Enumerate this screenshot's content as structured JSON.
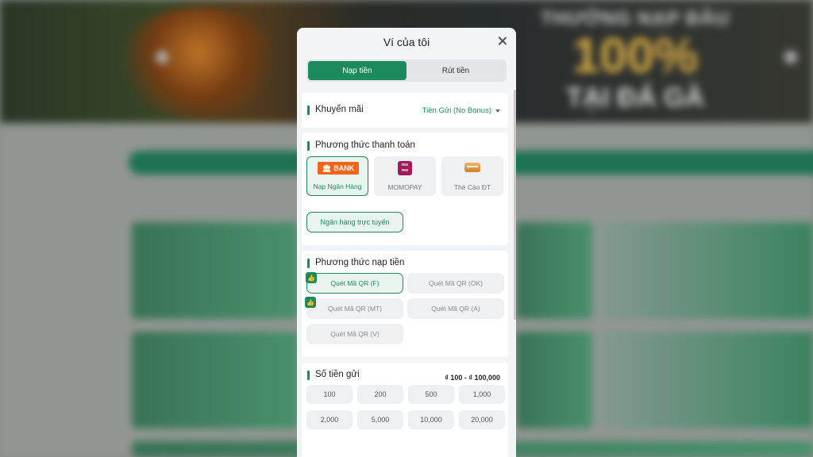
{
  "background": {
    "promo_line1": "THƯỞNG NẠP ĐẦU",
    "promo_line2": "100%",
    "promo_line3": "TẠI ĐÁ GÀ"
  },
  "wallet": {
    "title": "Ví của tôi",
    "tabs": [
      {
        "label": "Nạp tiền",
        "active": true
      },
      {
        "label": "Rút tiền",
        "active": false
      }
    ],
    "promotion": {
      "label": "Khuyến mãi",
      "selected": "Tiền Gửi (No Bonus)"
    },
    "payment_method": {
      "label": "Phương thức thanh toán",
      "options": [
        {
          "label": "Nạp Ngân Hàng",
          "icon": "bank-logo",
          "logo_text": "BANK",
          "active": true
        },
        {
          "label": "MOMOPAY",
          "icon": "momo-logo",
          "logo_text": "mo mo",
          "active": false
        },
        {
          "label": "Thẻ Cào ĐT",
          "icon": "phone-card-icon",
          "active": false
        }
      ],
      "sub_option": "Ngân hàng trực tuyến"
    },
    "deposit_method": {
      "label": "Phương thức nạp tiền",
      "options": [
        {
          "label": "Quét Mã QR (F)",
          "recommended": true,
          "active": true
        },
        {
          "label": "Quét Mã QR (OK)",
          "recommended": false,
          "active": false
        },
        {
          "label": "Quét Mã QR (MT)",
          "recommended": true,
          "active": false
        },
        {
          "label": "Quét Mã QR (A)",
          "recommended": false,
          "active": false
        },
        {
          "label": "Quét Mã QR (V)",
          "recommended": false,
          "active": false
        }
      ]
    },
    "deposit_amount": {
      "label": "Số tiền gửi",
      "range": "₫ 100 - ₫ 100,000",
      "amounts": [
        "100",
        "200",
        "500",
        "1,000",
        "2,000",
        "5,000",
        "10,000",
        "20,000"
      ]
    }
  },
  "colors": {
    "accent": "#1d8a5e",
    "bank_orange": "#f0641e",
    "momo": "#a3195b"
  }
}
